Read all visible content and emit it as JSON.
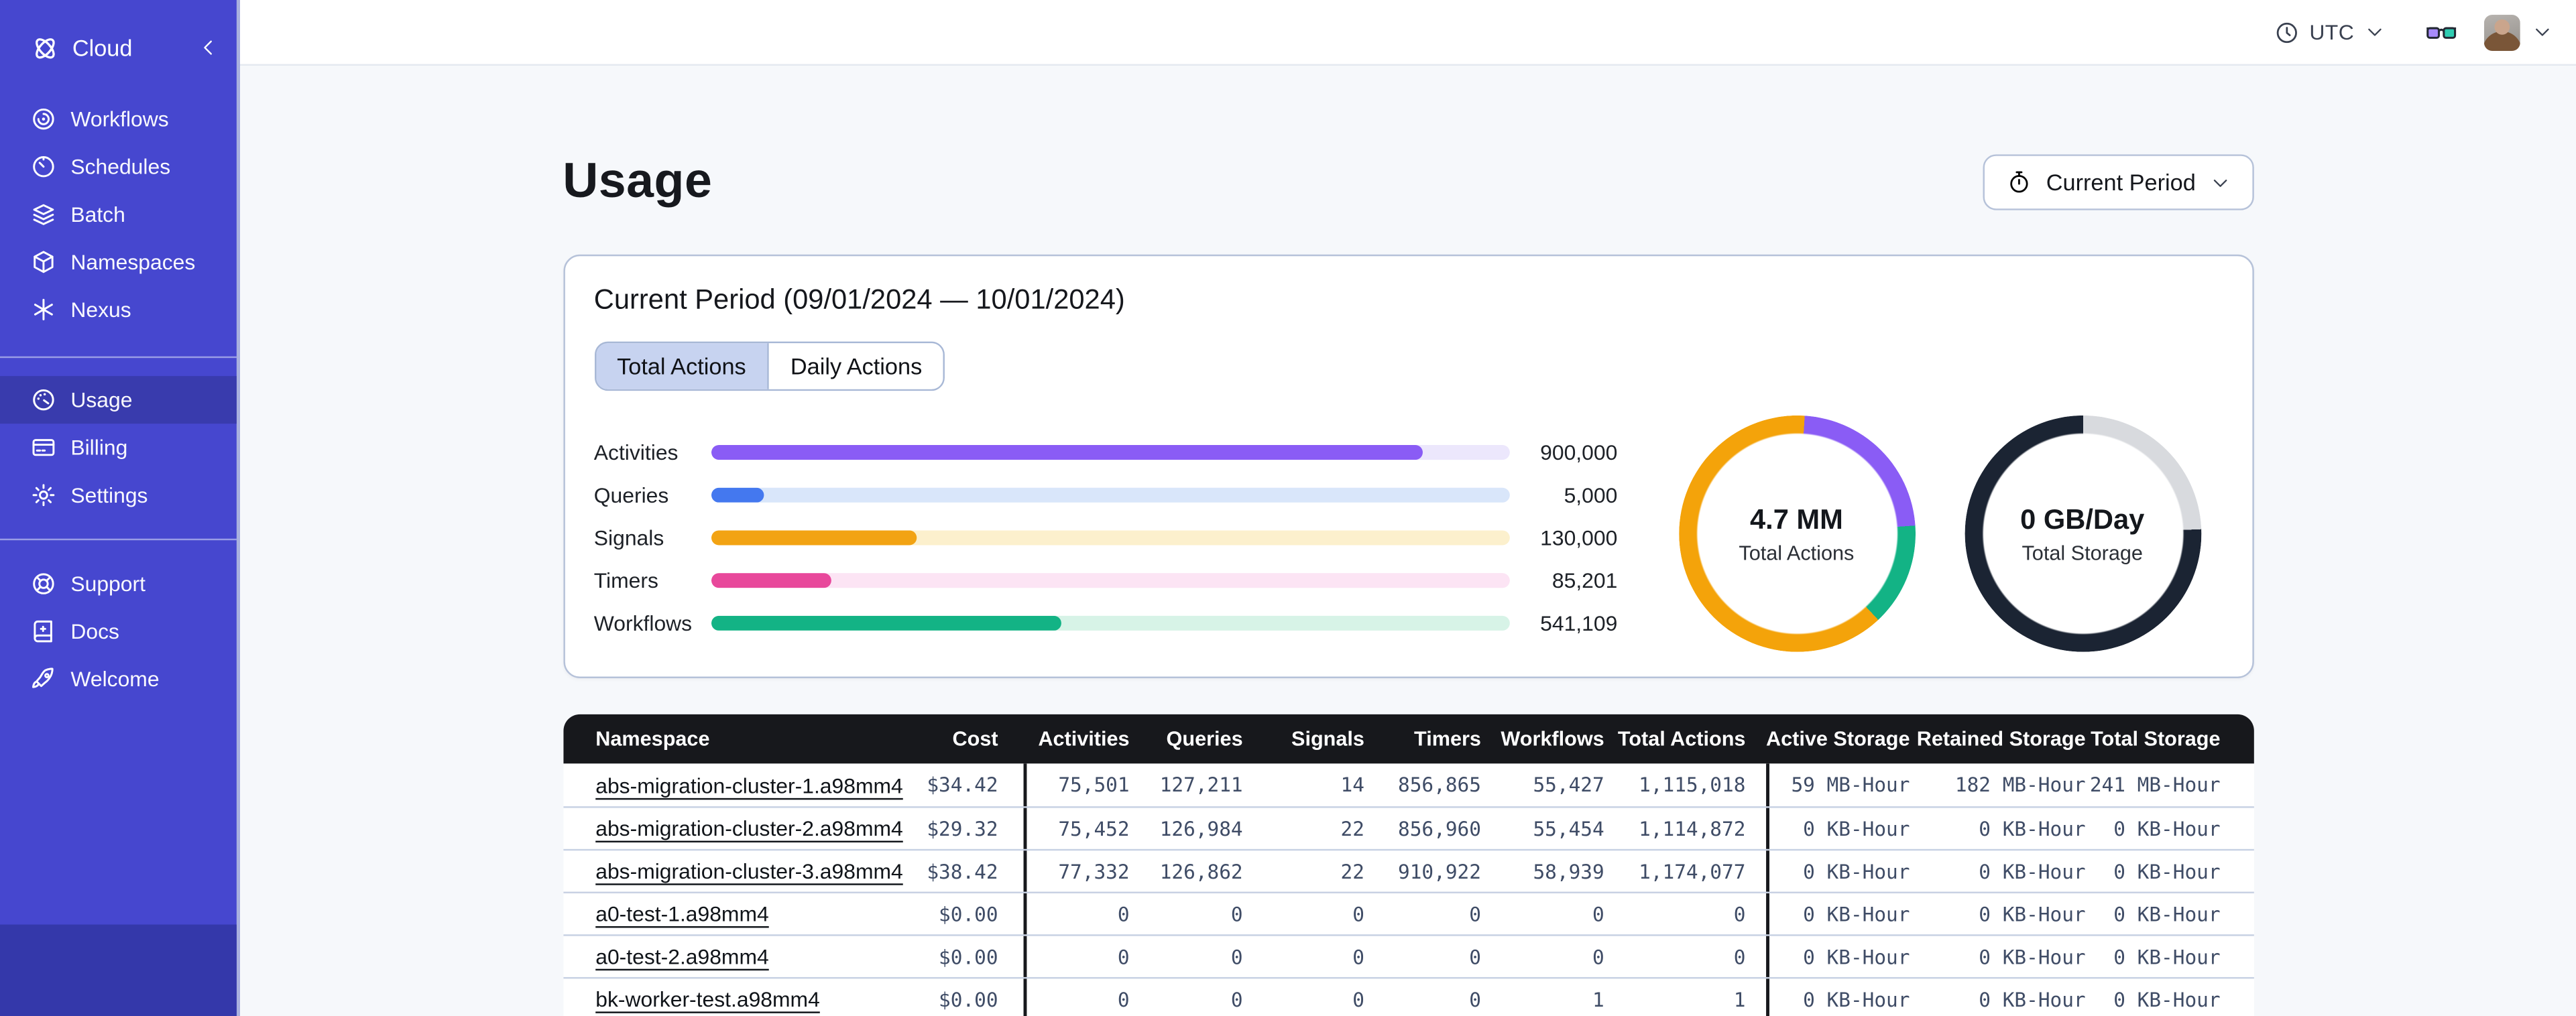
{
  "sidebar": {
    "header": {
      "label": "Cloud",
      "icon": "temporal-logo-icon",
      "collapse_icon": "chevron-left-icon"
    },
    "sections": [
      {
        "items": [
          {
            "label": "Workflows",
            "icon": "workflows-icon",
            "active": false
          },
          {
            "label": "Schedules",
            "icon": "schedules-icon",
            "active": false
          },
          {
            "label": "Batch",
            "icon": "batch-icon",
            "active": false
          },
          {
            "label": "Namespaces",
            "icon": "namespaces-icon",
            "active": false
          },
          {
            "label": "Nexus",
            "icon": "nexus-icon",
            "active": false
          }
        ]
      },
      {
        "items": [
          {
            "label": "Usage",
            "icon": "usage-icon",
            "active": true
          },
          {
            "label": "Billing",
            "icon": "billing-icon",
            "active": false
          },
          {
            "label": "Settings",
            "icon": "settings-icon",
            "active": false
          }
        ]
      },
      {
        "items": [
          {
            "label": "Support",
            "icon": "support-icon",
            "active": false
          },
          {
            "label": "Docs",
            "icon": "docs-icon",
            "active": false
          },
          {
            "label": "Welcome",
            "icon": "welcome-icon",
            "active": false
          }
        ]
      }
    ]
  },
  "topbar": {
    "timezone": {
      "icon": "clock-icon",
      "label": "UTC",
      "chevron": "chevron-down-icon"
    },
    "glasses_icon": "glasses-icon",
    "avatar": "user-avatar",
    "account_chevron": "chevron-down-icon"
  },
  "page": {
    "title": "Usage",
    "period_selector": {
      "icon": "stopwatch-icon",
      "label": "Current Period",
      "chevron": "chevron-down-icon"
    }
  },
  "usage_card": {
    "heading": "Current Period (09/01/2024 — 10/01/2024)",
    "tabs": [
      {
        "label": "Total Actions",
        "selected": true
      },
      {
        "label": "Daily Actions",
        "selected": false
      }
    ],
    "chart_data": [
      {
        "type": "bar",
        "title": "Actions by type (current period)",
        "categories": [
          "Activities",
          "Queries",
          "Signals",
          "Timers",
          "Workflows"
        ],
        "values": [
          900000,
          5000,
          130000,
          85201,
          541109
        ],
        "display_values": [
          "900,000",
          "5,000",
          "130,000",
          "85,201",
          "541,109"
        ],
        "percent_filled": [
          89.3,
          6.7,
          25.9,
          15.2,
          44
        ],
        "bar_colors": [
          "#8a5cf5",
          "#4478ef",
          "#f2a313",
          "#e8489b",
          "#13b385"
        ],
        "track_colors": [
          "#ece7fc",
          "#d9e6fa",
          "#fcf0cd",
          "#fce4f4",
          "#d7f3e7"
        ]
      },
      {
        "type": "pie",
        "name": "total-actions-donut",
        "center_value": "4.7 MM",
        "center_label": "Total Actions",
        "segments": [
          {
            "color": "#f4a30a",
            "from": 0,
            "to": 1
          },
          {
            "color": "#8a5cf5",
            "from": 1,
            "to": 23.9
          },
          {
            "color": "#13b385",
            "from": 23.9,
            "to": 38
          },
          {
            "color": "#f4a30a",
            "from": 38,
            "to": 100
          }
        ]
      },
      {
        "type": "pie",
        "name": "total-storage-donut",
        "center_value": "0 GB/Day",
        "center_label": "Total Storage",
        "segments": [
          {
            "color": "#d8dade",
            "from": 0,
            "to": 24.4
          },
          {
            "color": "#1b2433",
            "from": 24.4,
            "to": 100
          }
        ]
      }
    ]
  },
  "table": {
    "columns": [
      {
        "label": "Namespace",
        "key": "namespace"
      },
      {
        "label": "Cost",
        "key": "cost"
      },
      {
        "label": "Activities",
        "key": "activities"
      },
      {
        "label": "Queries",
        "key": "queries"
      },
      {
        "label": "Signals",
        "key": "signals"
      },
      {
        "label": "Timers",
        "key": "timers"
      },
      {
        "label": "Workflows",
        "key": "workflows"
      },
      {
        "label": "Total Actions",
        "key": "total_actions"
      },
      {
        "label": "Active Storage",
        "key": "active_storage"
      },
      {
        "label": "Retained Storage",
        "key": "retained_storage"
      },
      {
        "label": "Total Storage",
        "key": "total_storage"
      }
    ],
    "rows": [
      [
        "abs-migration-cluster-1.a98mm4",
        "$34.42",
        "75,501",
        "127,211",
        "14",
        "856,865",
        "55,427",
        "1,115,018",
        "59 MB-Hour",
        "182 MB-Hour",
        "241 MB-Hour"
      ],
      [
        "abs-migration-cluster-2.a98mm4",
        "$29.32",
        "75,452",
        "126,984",
        "22",
        "856,960",
        "55,454",
        "1,114,872",
        "0 KB-Hour",
        "0 KB-Hour",
        "0 KB-Hour"
      ],
      [
        "abs-migration-cluster-3.a98mm4",
        "$38.42",
        "77,332",
        "126,862",
        "22",
        "910,922",
        "58,939",
        "1,174,077",
        "0 KB-Hour",
        "0 KB-Hour",
        "0 KB-Hour"
      ],
      [
        "a0-test-1.a98mm4",
        "$0.00",
        "0",
        "0",
        "0",
        "0",
        "0",
        "0",
        "0 KB-Hour",
        "0 KB-Hour",
        "0 KB-Hour"
      ],
      [
        "a0-test-2.a98mm4",
        "$0.00",
        "0",
        "0",
        "0",
        "0",
        "0",
        "0",
        "0 KB-Hour",
        "0 KB-Hour",
        "0 KB-Hour"
      ],
      [
        "bk-worker-test.a98mm4",
        "$0.00",
        "0",
        "0",
        "0",
        "0",
        "1",
        "1",
        "0 KB-Hour",
        "0 KB-Hour",
        "0 KB-Hour"
      ]
    ]
  },
  "colors": {
    "sidebar_bg": "#4647cf",
    "sidebar_active_bg": "#393bad",
    "sidebar_bottom_bg": "#3438aa",
    "table_header_bg": "#17181c",
    "tab_selected_bg": "#c7d3f0",
    "card_border": "#b6c2d9",
    "numeric_text": "#3f4c66",
    "glasses_left_lens": "#a78bfa",
    "glasses_right_lens": "#2fcdb2"
  }
}
